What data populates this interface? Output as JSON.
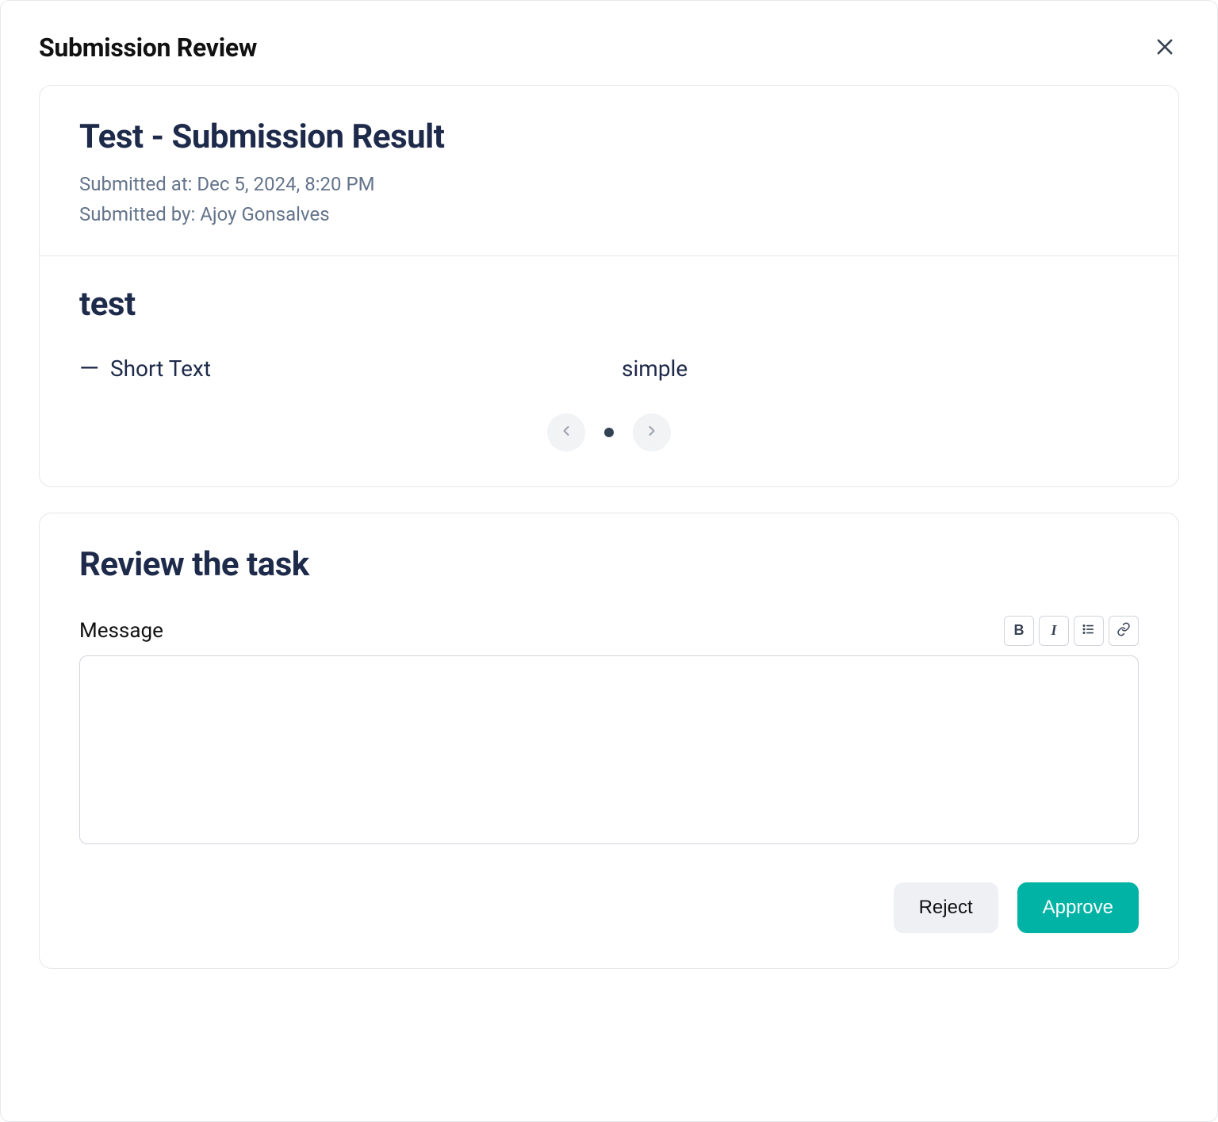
{
  "modal": {
    "title": "Submission Review"
  },
  "result": {
    "title": "Test - Submission Result",
    "submitted_at": "Submitted at: Dec 5, 2024, 8:20 PM",
    "submitted_by": "Submitted by: Ajoy Gonsalves"
  },
  "section": {
    "title": "test"
  },
  "field": {
    "label": "Short Text",
    "value": "simple"
  },
  "review": {
    "title": "Review the task",
    "message_label": "Message",
    "message_value": ""
  },
  "toolbar": {
    "bold": "B",
    "italic": "I"
  },
  "actions": {
    "reject": "Reject",
    "approve": "Approve"
  }
}
